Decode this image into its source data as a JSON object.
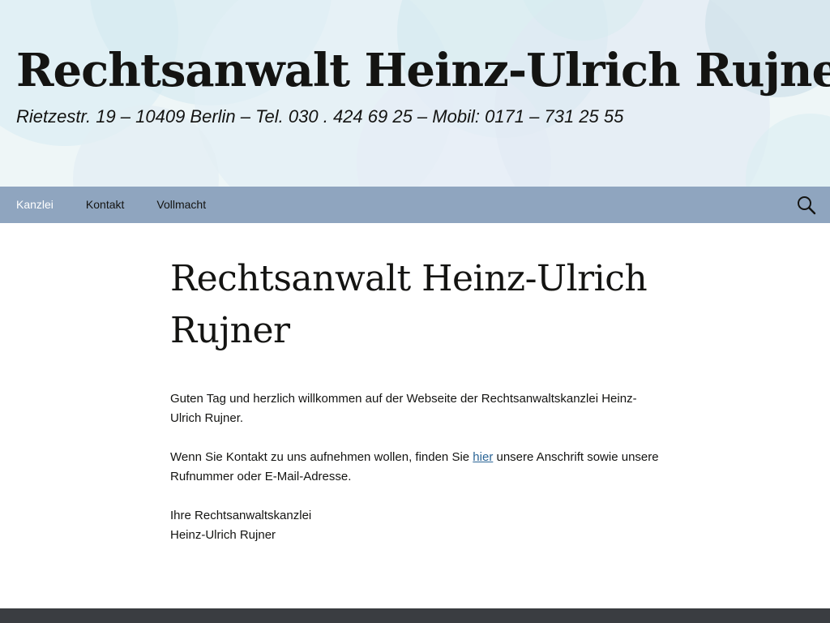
{
  "header": {
    "site_title": "Rechtsanwalt Heinz-Ulrich Rujner",
    "site_description": "Rietzestr. 19 – 10409 Berlin – Tel. 030 . 424 69 25 – Mobil: 0171 – 731 25 55"
  },
  "nav": {
    "items": [
      {
        "label": "Kanzlei",
        "active": true
      },
      {
        "label": "Kontakt",
        "active": false
      },
      {
        "label": "Vollmacht",
        "active": false
      }
    ],
    "search_icon": "search-icon"
  },
  "entry": {
    "title": "Rechtsanwalt Heinz-Ulrich Rujner",
    "p1": "Guten Tag und herzlich willkommen auf der Webseite der Rechtsanwaltskanzlei Heinz-Ulrich Rujner.",
    "p2_before": "Wenn Sie Kontakt zu uns aufnehmen wollen, finden Sie ",
    "p2_link": "hier",
    "p2_after": " unsere Anschrift sowie unsere Rufnummer oder E-Mail-Adresse.",
    "sign_line1": "Ihre Rechtsanwaltskanzlei",
    "sign_line2": "Heinz-Ulrich Rujner"
  },
  "colors": {
    "nav_bg": "#8fa5bf",
    "nav_active": "#ffffff",
    "link": "#2a6496",
    "footer_bg": "#3a3d41",
    "text": "#141412"
  }
}
